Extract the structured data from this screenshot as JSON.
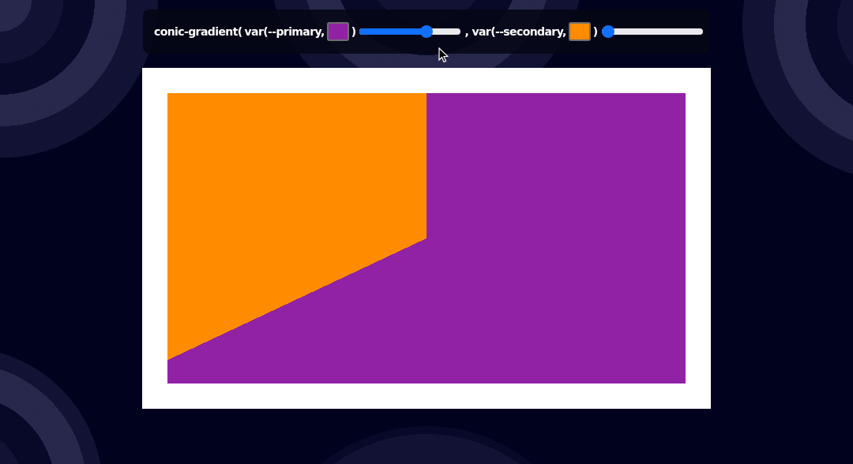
{
  "toolbar": {
    "prefix": "conic-gradient(",
    "stops": [
      {
        "label": "var(--primary,",
        "color": "#9122a5",
        "close": ")",
        "level": 0.68
      },
      {
        "label": ", var(--secondary,",
        "color": "#ff8c00",
        "close": ")",
        "level": 0.0
      }
    ]
  }
}
